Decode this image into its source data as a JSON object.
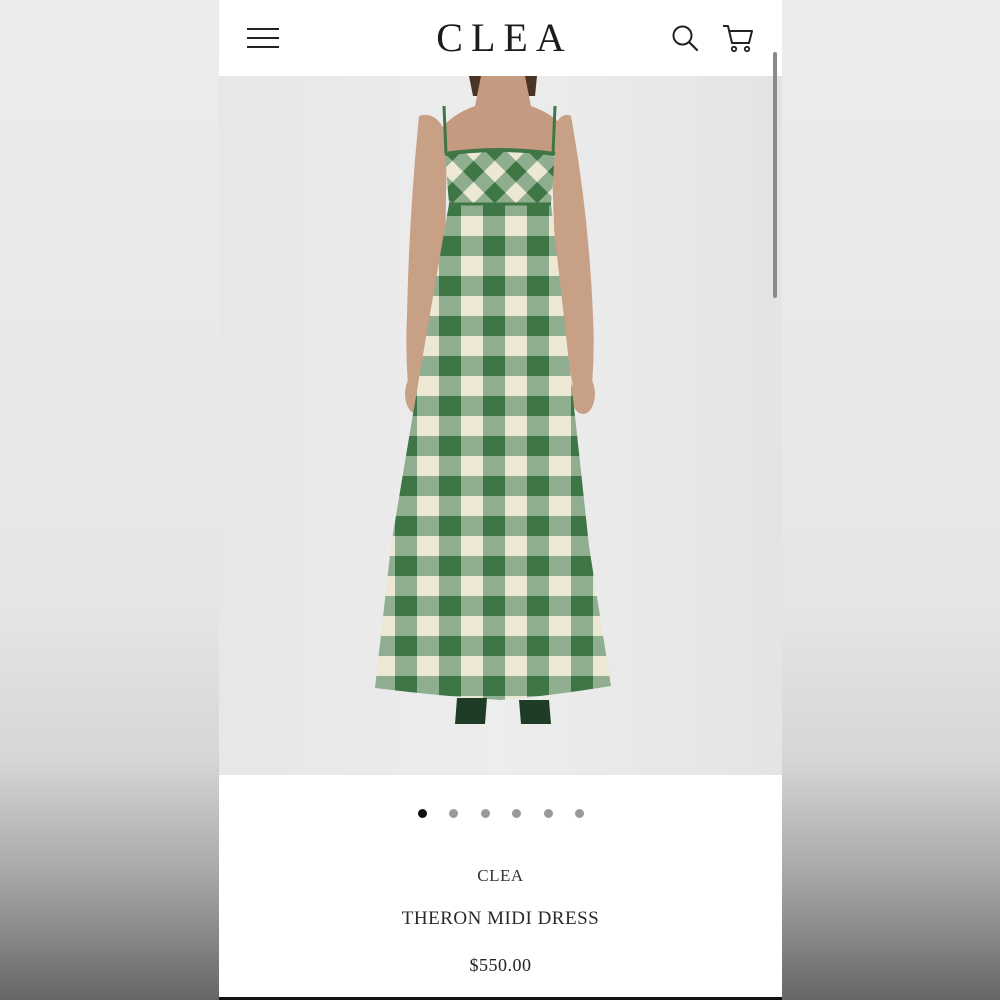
{
  "header": {
    "brand": "CLEA",
    "menu_icon": "hamburger-menu-icon",
    "search_icon": "search-icon",
    "cart_icon": "shopping-cart-icon"
  },
  "gallery": {
    "image": "product-photo-green-gingham-dress",
    "slide_count": 6,
    "active_index": 0
  },
  "product": {
    "brand": "CLEA",
    "title": "THERON MIDI DRESS",
    "price": "$550.00"
  },
  "colors": {
    "dress_green": "#3f7646",
    "dress_cream": "#ece8d3",
    "dress_mid": "#8fae8f"
  }
}
